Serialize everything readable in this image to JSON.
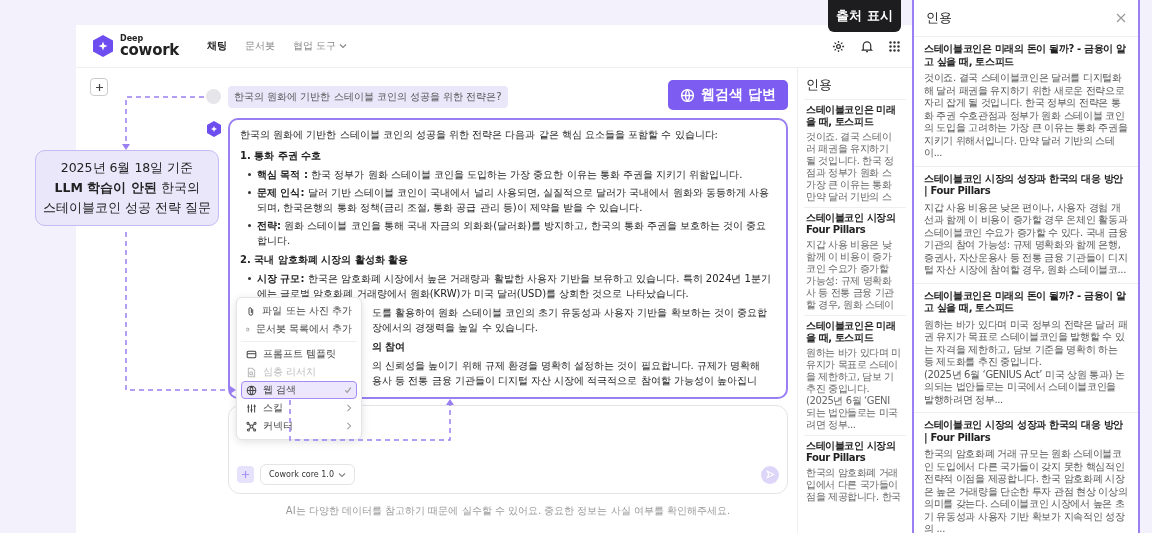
{
  "header": {
    "logo_top": "Deep",
    "logo_bottom": "cowork",
    "nav": [
      {
        "label": "채팅",
        "selected": true,
        "has_menu": false
      },
      {
        "label": "문서봇",
        "selected": false,
        "has_menu": false
      },
      {
        "label": "협업 도구",
        "selected": false,
        "has_menu": true
      }
    ]
  },
  "tooltip": "출처 표시",
  "question": "한국의 원화에 기반한 스테이블 코인의 성공을 위한 전략은?",
  "badge": "웹검색 답변",
  "annotation": "2025년 6월 18일 기준\n**LLM 학습이 안된** 한국의\n스테이블코인 성공 전략 질문",
  "answer": {
    "intro": "한국의 원화에 기반한 스테이블 코인의 성공을 위한 전략은 다음과 같은 핵심 요소들을 포함할 수 있습니다:",
    "sections": [
      {
        "heading": "1. 통화 주권 수호",
        "bullets": [
          "**핵심 목적 :** 한국 정부가 원화 스테이블 코인을 도입하는 가장 중요한 이유는 통화 주권을 지키기 위함입니다.",
          "**문제 인식:** 달러 기반 스테이블 코인이 국내에서 널리 사용되면, 실질적으로 달러가 국내에서 원화와 동등하게 사용되며, 한국은행의 통화 정책(금리 조절, 통화 공급 관리 등)이 제약을 받을 수 있습니다.",
          "**전략:** 원화 스테이블 코인을 통해 국내 자금의 외화화(달러화)를 방지하고, 한국의 통화 주권을 보호하는 것이 중요합니다."
        ]
      },
      {
        "heading": "2. 국내 암호화폐 시장의 활성화 활용",
        "bullets": [
          "**시장 규모:** 한국은 암호화폐 시장에서 높은 거래량과 활발한 사용자 기반을 보유하고 있습니다. 특히 2024년 1분기에는 글로벌 암호화폐 거래량에서 원화(KRW)가 미국 달러(USD)를 상회한 것으로 나타났습니다."
        ]
      }
    ],
    "partial_lines": [
      {
        "kind": "text",
        "text": "도를 활용하여 원화 스테이블 코인의 초기 유동성과 사용자 기반을 확보하는 것이 중요합"
      },
      {
        "kind": "text",
        "text": "장에서의 경쟁력을 높일 수 있습니다."
      },
      {
        "kind": "heading",
        "text": "의 참여"
      },
      {
        "kind": "text",
        "text": "의 신뢰성을 높이기 위해 규제 환경을 명확히 설정하는 것이 필요합니다. 규제가 명확해"
      },
      {
        "kind": "text",
        "text": "용사 등 전통 금융 기관들이 디지털 자산 시장에 적극적으로 참여할 가능성이 높아집니"
      }
    ]
  },
  "menu": {
    "groups": [
      [
        {
          "kind": "file",
          "label": "파일 또는 사진 추가",
          "disabled": false,
          "selected": false,
          "submenu": false
        },
        {
          "kind": "doc",
          "label": "문서봇 목록에서 추가",
          "disabled": false,
          "selected": false,
          "submenu": false
        }
      ],
      [
        {
          "kind": "template",
          "label": "프롬프트 템플릿",
          "disabled": false,
          "selected": false,
          "submenu": false
        },
        {
          "kind": "research",
          "label": "심층 리서치",
          "disabled": true,
          "selected": false,
          "submenu": false
        },
        {
          "kind": "web",
          "label": "웹 검색",
          "disabled": false,
          "selected": true,
          "submenu": false
        },
        {
          "kind": "skill",
          "label": "스킬",
          "disabled": false,
          "selected": false,
          "submenu": true
        },
        {
          "kind": "connector",
          "label": "커넥터",
          "disabled": false,
          "selected": false,
          "submenu": true
        }
      ]
    ]
  },
  "input": {
    "model": "Cowork core 1.0"
  },
  "disclaimer": "AI는 다양한 데이터를 참고하기 때문에 실수할 수 있어요. 중요한 정보는 사실 여부를 확인해주세요.",
  "citations_behind": {
    "title": "인용",
    "cards": [
      {
        "title_lines": [
          "스테이블코인은 미래",
          "을 때, 토스피드"
        ],
        "body_lines": [
          "것이죠. 결국 스테이",
          "러 패권을 유지하기",
          "될 것입니다. 한국 정",
          "점과 정부가 원화 스",
          "가장 큰 이유는 통화",
          "만약 달러 기반의 스"
        ]
      },
      {
        "title_lines": [
          "스테이블코인 시장의",
          "Four Pillars"
        ],
        "body_lines": [
          "지갑 사용 비용은 낮",
          "함께 이 비용이 증가",
          "코인 수요가 증가할",
          "가능성: 규제 명확화",
          "사 등 전통 금융 기관",
          "할 경우, 원화 스테이"
        ]
      },
      {
        "title_lines": [
          "스테이블코인은 미래",
          "을 때, 토스피드"
        ],
        "body_lines": [
          "원하는 바가 있다며 미",
          "유지가 목표로 스테이",
          "을 제한하고, 담보 기",
          "추진 중입니다.",
          "(2025년 6월 ‘GENI",
          "되는 법안들로는 미국",
          "려면 정부..."
        ]
      },
      {
        "title_lines": [
          "스테이블코인 시장의",
          "Four Pillars"
        ],
        "body_lines": [
          "한국의 암호화폐 거래",
          "입에서 다른 국가들이",
          "점을 제공합니다. 한국"
        ]
      }
    ]
  },
  "citations_panel": {
    "title": "인용",
    "cards": [
      {
        "title": "스테이블코인은 미래의 돈이 될까? - 금융이 알고 싶을 때, 토스피드",
        "body": "것이죠. 결국 스테이블코인은 달러를 디지털화해 달러 패권을 유지하기 위한 새로운 전략으로 자리 잡게 될 것입니다. 한국 정부의 전략은 통화 주권 수호관점과 정부가 원화 스테이블 코인의 도입을 고려하는 가장 큰 이유는 통화 주권을 지키기 위해서입니다. 만약 달러 기반의 스테이..."
      },
      {
        "title": "스테이블코인 시장의 성장과 한국의 대응 방안 | Four Pillars",
        "body": "지갑 사용 비용은 낮은 편이나, 사용자 경험 개선과 함께 이 비용이 증가할 경우 온체인 활동과 스테이블코인 수요가 증가할 수 있다. 국내 금융 기관의 참여 가능성: 규제 명확화와 함께 은행, 증권사, 자산운용사 등 전통 금융 기관들이 디지털 자산 시장에 참여할 경우, 원화 스테이블코..."
      },
      {
        "title": "스테이블코인은 미래의 돈이 될까? - 금융이 알고 싶을 때, 토스피드",
        "body": "원하는 바가 있다며 미국 정부의 전략은 달러 패권 유지가 목표로 스테이블코인을 발행할 수 있는 자격을 제한하고, 담보 기준을 명확히 하는 등 제도화를 추진 중입니다.\n(2025년 6월 ‘GENIUS Act’ 미국 상원 통과) 논의되는 법안들로는 미국에서 스테이블코인을 발행하려면 정부..."
      },
      {
        "title": "스테이블코인 시장의 성장과 한국의 대응 방안 | Four Pillars",
        "body": "한국의 암호화폐 거래 규모는 원화 스테이블코인 도입에서 다른 국가들이 갖지 못한 핵심적인 전략적 이점을 제공합니다. 한국 암호화폐 시장은 높은 거래량을 단순한 투자 관점 현상 이상의 의미를 갖는다. 스테이블코인 시장에서 높은 초기 유동성과 사용자 기반 확보가 지속적인 성장의 ..."
      }
    ]
  }
}
